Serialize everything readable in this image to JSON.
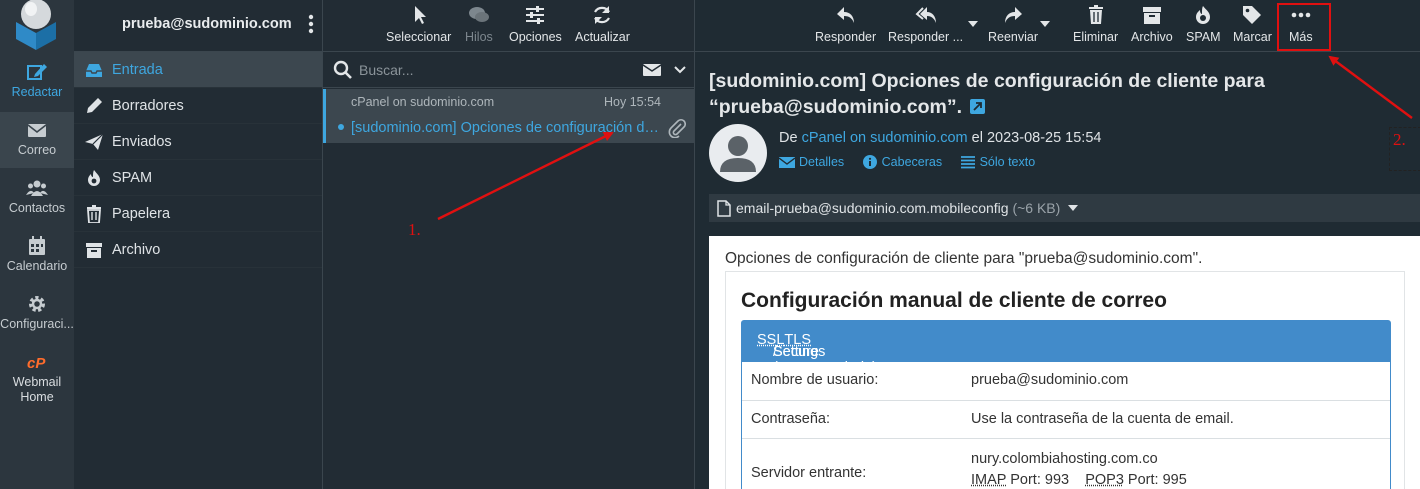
{
  "account": {
    "email": "prueba@sudominio.com"
  },
  "rail": {
    "items": [
      {
        "label": "Redactar"
      },
      {
        "label": "Correo"
      },
      {
        "label": "Contactos"
      },
      {
        "label": "Calendario"
      },
      {
        "label": "Configuraci..."
      },
      {
        "label": "Webmail Home"
      }
    ]
  },
  "folders": [
    {
      "label": "Entrada",
      "icon": "inbox-icon"
    },
    {
      "label": "Borradores",
      "icon": "pencil-icon"
    },
    {
      "label": "Enviados",
      "icon": "paper-plane-icon"
    },
    {
      "label": "SPAM",
      "icon": "fire-icon"
    },
    {
      "label": "Papelera",
      "icon": "trash-icon"
    },
    {
      "label": "Archivo",
      "icon": "archive-icon"
    }
  ],
  "list_toolbar": {
    "select": "Seleccionar",
    "threads": "Hilos",
    "options": "Opciones",
    "refresh": "Actualizar"
  },
  "search": {
    "placeholder": "Buscar..."
  },
  "messages": [
    {
      "from": "cPanel on sudominio.com",
      "date": "Hoy 15:54",
      "subject": "[sudominio.com] Opciones de configuración de cliente para “prueba@sudominio.com”."
    }
  ],
  "view_toolbar": {
    "reply": "Responder",
    "reply_all": "Responder ...",
    "forward": "Reenviar",
    "delete": "Eliminar",
    "archive": "Archivo",
    "spam": "SPAM",
    "mark": "Marcar",
    "more": "Más"
  },
  "message": {
    "subject": "[sudominio.com] Opciones de configuración de cliente para “prueba@sudominio.com”.",
    "from_prefix": "De",
    "from": "cPanel on sudominio.com",
    "date_prefix": "el",
    "date": "2023-08-25 15:54",
    "links": {
      "details": "Detalles",
      "headers": "Cabeceras",
      "plain": "Sólo texto"
    },
    "attachment": {
      "name": "email-prueba@sudominio.com.mobileconfig",
      "size": "(~6 KB)"
    },
    "body": {
      "intro": "Opciones de configuración de cliente para \"prueba@sudominio.com\".",
      "heading": "Configuración manual de cliente de correo",
      "section_pre": "Secure ",
      "ssl": "SSL",
      "slash": "/",
      "tls": "TLS",
      "section_post": " Settings (Recomendado)",
      "rows": [
        {
          "key": "Nombre de usuario:",
          "value": "prueba@sudominio.com"
        },
        {
          "key": "Contraseña:",
          "value": "Use la contraseña de la cuenta de email."
        },
        {
          "key": "Servidor entrante:",
          "value": "nury.colombiahosting.com.co"
        }
      ],
      "imap": "IMAP",
      "imap_port": " Port: 993",
      "pop3": "POP3",
      "pop3_port": " Port: 995"
    }
  },
  "annotations": {
    "step1": "1.",
    "step2": "2.",
    "color": "#e01010"
  },
  "colors": {
    "accent": "#3ea7e0",
    "table_header": "#428bca",
    "bg": "#1f2b33"
  }
}
